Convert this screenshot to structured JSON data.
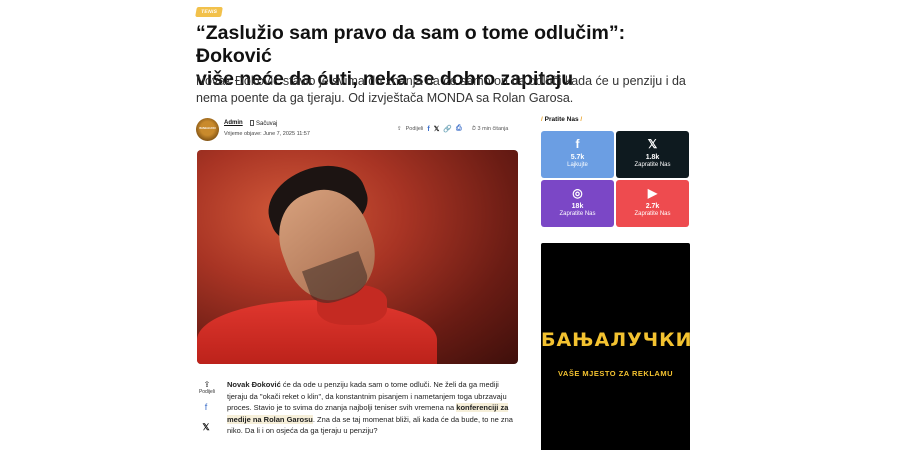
{
  "article": {
    "category": "TENIS",
    "title_line1": "“Zaslužio sam pravo da sam o tome odlučim”: Đoković",
    "title_line2": "više neće da ćuti, neka se dobro zapitaju",
    "lead": "Novak Đoković stavio je svima do znanja da će samo on da odluči kada će u penziju i da nema poente da ga tjeraju. Od izvještača MONDA sa Rolan Garosa."
  },
  "meta": {
    "avatar_text": "BANJALUCKI",
    "author": "Admin",
    "save_label": "Sačuvaj",
    "published": "Vrijeme objave: June 7, 2025 11:57",
    "share_label": "Podijeli",
    "read_time": "3 min čitanja"
  },
  "body": {
    "share_label": "Podijeli",
    "p1_name": "Novak Đoković",
    "p1_a": " će da ode u penziju kada sam o tome odluči. Ne želi da ga mediji tjeraju da \"okači reket o klin\", da konstantnim pisanjem i nametanjem toga ubrzavaju proces. Stavio je to svima do znanja najbolji teniser svih vremena na ",
    "p1_link": "konferenciji za medije na Rolan Garosu",
    "p1_b": ". Zna da se taj momenat bliži, ali kada će da bude, to ne zna niko. Da li i on osjeća da ga tjeraju u penziju?"
  },
  "sidebar": {
    "follow_title": "Pratite Nas",
    "socials": [
      {
        "icon": "facebook-icon",
        "count": "5.7k",
        "label": "Lajkujte",
        "color": "#6b9ee3"
      },
      {
        "icon": "x-icon",
        "count": "1.8k",
        "label": "Zapratite Nas",
        "color": "#0e1a1f"
      },
      {
        "icon": "instagram-icon",
        "count": "18k",
        "label": "Zapratite Nas",
        "color": "#7b47c6"
      },
      {
        "icon": "youtube-icon",
        "count": "2.7k",
        "label": "Zapratite Nas",
        "color": "#ee4b4f"
      }
    ],
    "ad_title": "БАЊАЛУЧКИ",
    "ad_subtitle": "VAŠE MJESTO ZA REKLAMU"
  }
}
